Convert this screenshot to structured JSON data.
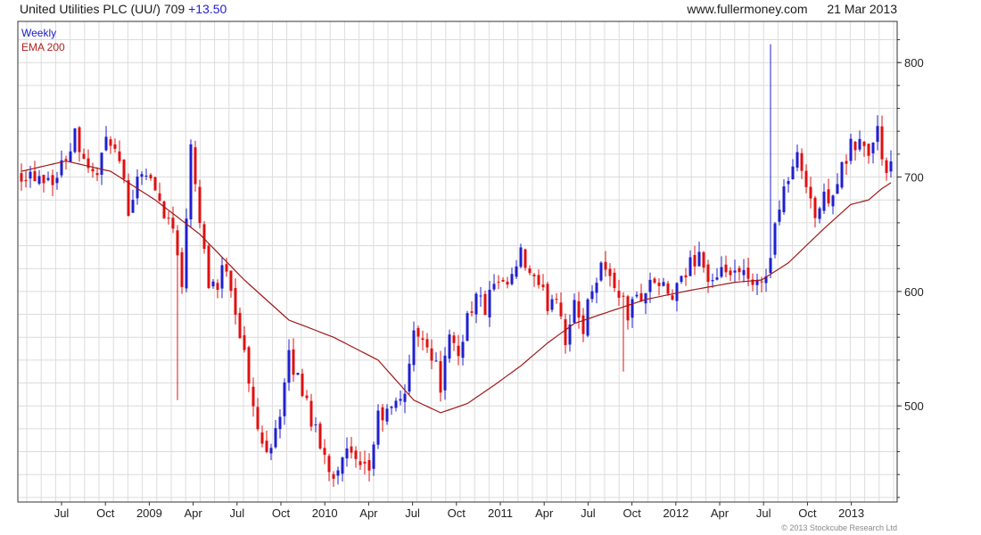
{
  "header": {
    "title": "United Utilities PLC (UU/) 709",
    "change": "+13.50",
    "website": "www.fullermoney.com",
    "date": "21 Mar 2013"
  },
  "legend": {
    "series1": "Weekly",
    "series2": "EMA 200"
  },
  "copyright": "© 2013 Stockcube Research Ltd",
  "colors": {
    "up": "#1f1fd0",
    "down": "#e01010",
    "ema": "#a01818",
    "grid": "#dcdcdc",
    "axis": "#333333"
  },
  "chart_data": {
    "type": "candlestick",
    "ylim": [
      416,
      836
    ],
    "y_ticks": [
      500,
      600,
      700,
      800
    ],
    "x_ticks": [
      "Jul",
      "Oct",
      "2009",
      "Apr",
      "Jul",
      "Oct",
      "2010",
      "Apr",
      "Jul",
      "Oct",
      "2011",
      "Apr",
      "Jul",
      "Oct",
      "2012",
      "Apr",
      "Jul",
      "Oct",
      "2013"
    ],
    "grid": true,
    "close_path": [
      [
        0,
        705
      ],
      [
        8,
        700
      ],
      [
        12,
        740
      ],
      [
        16,
        700
      ],
      [
        20,
        735
      ],
      [
        24,
        675
      ],
      [
        27,
        710
      ],
      [
        31,
        680
      ],
      [
        34,
        655
      ],
      [
        34.5,
        555
      ],
      [
        35,
        640
      ],
      [
        36,
        600
      ],
      [
        38,
        735
      ],
      [
        40,
        665
      ],
      [
        42,
        610
      ],
      [
        44,
        605
      ],
      [
        46,
        625
      ],
      [
        48,
        585
      ],
      [
        50,
        545
      ],
      [
        52,
        495
      ],
      [
        54,
        465
      ],
      [
        56,
        470
      ],
      [
        58,
        495
      ],
      [
        60,
        540
      ],
      [
        62,
        525
      ],
      [
        64,
        505
      ],
      [
        66,
        475
      ],
      [
        68,
        455
      ],
      [
        70,
        440
      ],
      [
        72,
        460
      ],
      [
        74,
        455
      ],
      [
        76,
        440
      ],
      [
        78,
        445
      ],
      [
        80,
        490
      ],
      [
        82,
        492
      ],
      [
        84,
        500
      ],
      [
        86,
        515
      ],
      [
        88,
        560
      ],
      [
        90,
        565
      ],
      [
        92,
        545
      ],
      [
        94,
        520
      ],
      [
        96,
        555
      ],
      [
        98,
        545
      ],
      [
        100,
        580
      ],
      [
        102,
        595
      ],
      [
        104,
        585
      ],
      [
        106,
        605
      ],
      [
        108,
        600
      ],
      [
        110,
        610
      ],
      [
        112,
        630
      ],
      [
        114,
        615
      ],
      [
        116,
        600
      ],
      [
        118,
        590
      ],
      [
        120,
        600
      ],
      [
        122,
        560
      ],
      [
        124,
        585
      ],
      [
        126,
        570
      ],
      [
        128,
        605
      ],
      [
        130,
        625
      ],
      [
        132,
        612
      ],
      [
        134,
        600
      ],
      [
        136,
        580
      ],
      [
        138,
        595
      ],
      [
        140,
        600
      ],
      [
        142,
        610
      ],
      [
        144,
        600
      ],
      [
        146,
        595
      ],
      [
        148,
        605
      ],
      [
        150,
        625
      ],
      [
        152,
        635
      ],
      [
        154,
        610
      ],
      [
        156,
        605
      ],
      [
        158,
        620
      ],
      [
        160,
        610
      ],
      [
        162,
        615
      ],
      [
        164,
        600
      ],
      [
        166,
        610
      ],
      [
        168,
        630
      ],
      [
        170,
        680
      ],
      [
        172,
        700
      ],
      [
        174,
        715
      ],
      [
        176,
        700
      ],
      [
        178,
        665
      ],
      [
        180,
        680
      ],
      [
        182,
        690
      ],
      [
        184,
        705
      ],
      [
        186,
        725
      ],
      [
        188,
        730
      ],
      [
        190,
        720
      ],
      [
        192,
        740
      ],
      [
        194,
        700
      ],
      [
        195,
        709
      ]
    ],
    "ema_path": [
      [
        0,
        705
      ],
      [
        10,
        714
      ],
      [
        20,
        705
      ],
      [
        30,
        680
      ],
      [
        40,
        650
      ],
      [
        50,
        610
      ],
      [
        60,
        575
      ],
      [
        70,
        560
      ],
      [
        80,
        540
      ],
      [
        88,
        505
      ],
      [
        94,
        494
      ],
      [
        100,
        502
      ],
      [
        106,
        518
      ],
      [
        112,
        535
      ],
      [
        118,
        555
      ],
      [
        124,
        572
      ],
      [
        130,
        580
      ],
      [
        140,
        593
      ],
      [
        150,
        601
      ],
      [
        160,
        608
      ],
      [
        166,
        610
      ],
      [
        172,
        625
      ],
      [
        180,
        655
      ],
      [
        186,
        676
      ],
      [
        190,
        680
      ],
      [
        193,
        690
      ],
      [
        195,
        695
      ]
    ]
  }
}
